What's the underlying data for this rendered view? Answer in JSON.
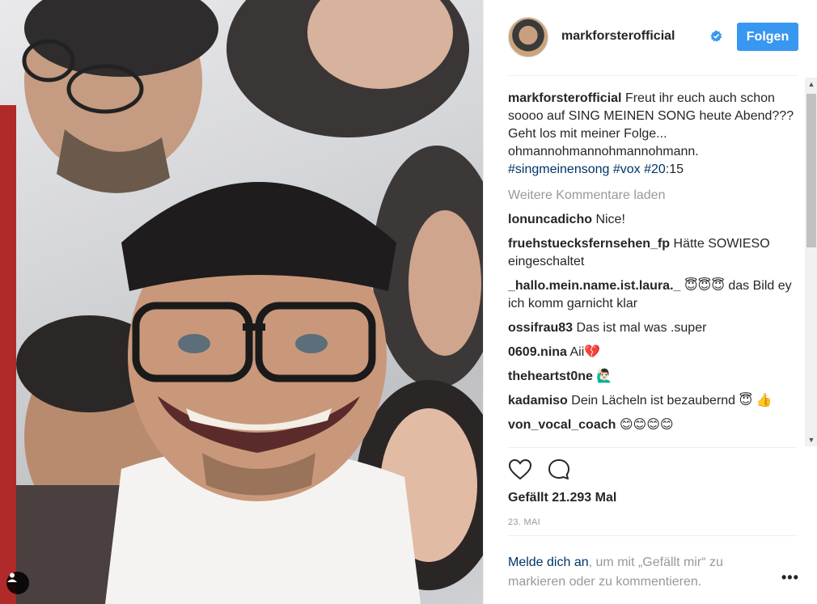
{
  "post": {
    "username": "markforsterofficial",
    "verified": true,
    "follow_label": "Folgen",
    "caption_text": " Freut ihr euch auch schon soooo auf SING MEINEN SONG heute Abend??? Geht los mit meiner Folge... ohmannohmannohmannohmann. ",
    "caption_tags": [
      "#singmeinensong",
      "#vox",
      "#20"
    ],
    "caption_tail": ":15",
    "load_more": "Weitere Kommentare laden",
    "comments": [
      {
        "user": "lonuncadicho",
        "text": " Nice!"
      },
      {
        "user": "fruehstuecksfernsehen_fp",
        "text": " Hätte SOWIESO eingeschaltet"
      },
      {
        "user": "_hallo.mein.name.ist.laura._",
        "text": " 😇😇😇 das Bild ey ich komm garnicht klar"
      },
      {
        "user": "ossifrau83",
        "text": " Das ist mal was .super"
      },
      {
        "user": "0609.nina",
        "text": " Aii💔"
      },
      {
        "user": "theheartst0ne",
        "text": " 🙋🏻‍♂️"
      },
      {
        "user": "kadamiso",
        "text": " Dein Lächeln ist bezaubernd 😇 👍"
      },
      {
        "user": "von_vocal_coach",
        "text": " 😊😊😊😊"
      }
    ],
    "likes": "Gefällt 21.293 Mal",
    "date": "23. MAI",
    "login_link": "Melde dich an",
    "login_text": ", um mit „Gefällt mir“ zu markieren oder zu kommentieren.",
    "more_options": "•••"
  },
  "icons": {
    "like": "heart-outline-icon",
    "comment": "speech-bubble-icon",
    "user_tag": "person-icon",
    "verified": "verified-badge-icon"
  },
  "colors": {
    "follow_button": "#3897f0",
    "link": "#003569",
    "muted": "#999999",
    "verified": "#3897f0"
  }
}
